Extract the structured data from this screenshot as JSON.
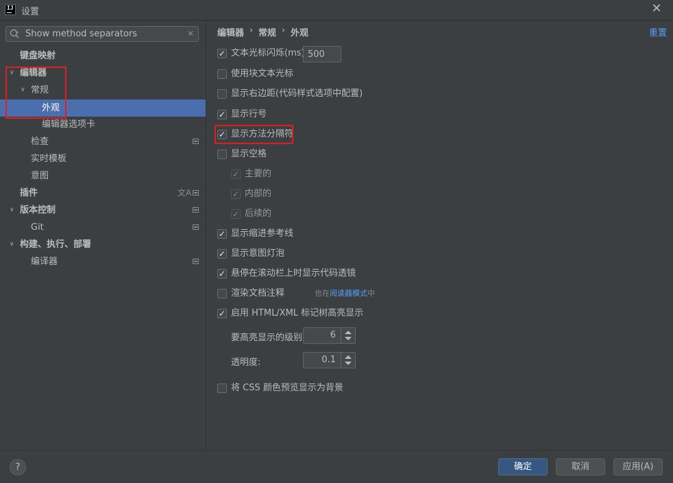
{
  "window": {
    "title": "设置"
  },
  "search": {
    "value": "Show method separators",
    "placeholder": ""
  },
  "tree": {
    "keymap": "键盘映射",
    "editor": "编辑器",
    "general": "常规",
    "appearance": "外观",
    "editor_tabs": "编辑器选项卡",
    "inspections": "检查",
    "live_templates": "实时模板",
    "intentions": "意图",
    "plugins": "插件",
    "vcs": "版本控制",
    "git": "Git",
    "build": "构建、执行、部署",
    "compiler": "编译器"
  },
  "breadcrumb": {
    "a": "编辑器",
    "b": "常规",
    "c": "外观",
    "sep": "›"
  },
  "reset": "重置",
  "options": {
    "caret_blink": {
      "label": "文本光标闪烁(ms):",
      "checked": true,
      "value": "500"
    },
    "block_caret": {
      "label": "使用块文本光标",
      "checked": false
    },
    "right_margin": {
      "label": "显示右边距(代码样式选项中配置)",
      "checked": false
    },
    "line_numbers": {
      "label": "显示行号",
      "checked": true
    },
    "method_separators": {
      "label": "显示方法分隔符",
      "checked": true
    },
    "whitespaces": {
      "label": "显示空格",
      "checked": false
    },
    "ws_leading": {
      "label": "主要的",
      "checked": true
    },
    "ws_inner": {
      "label": "内部的",
      "checked": true
    },
    "ws_trailing": {
      "label": "后续的",
      "checked": true
    },
    "indent_guides": {
      "label": "显示缩进参考线",
      "checked": true
    },
    "intention_bulb": {
      "label": "显示意图灯泡",
      "checked": true
    },
    "code_lens": {
      "label": "悬停在滚动栏上时显示代码透镜",
      "checked": true
    },
    "render_docs": {
      "label": "渲染文档注释",
      "checked": false
    },
    "render_hint_pre": "也在",
    "render_hint_link": "阅读器模式",
    "render_hint_post": "中",
    "html_tree": {
      "label": "启用 HTML/XML 标记树高亮显示",
      "checked": true
    },
    "levels_label": "要高亮显示的级别:",
    "levels_value": "6",
    "opacity_label": "透明度:",
    "opacity_value": "0.1",
    "css_color": {
      "label": "将 CSS 颜色预览显示为背景",
      "checked": false
    }
  },
  "buttons": {
    "help": "?",
    "ok": "确定",
    "cancel": "取消",
    "apply": "应用(A)"
  },
  "colors": {
    "accent": "#4b6eaf",
    "link": "#589df6",
    "highlight_box": "#e02020"
  }
}
